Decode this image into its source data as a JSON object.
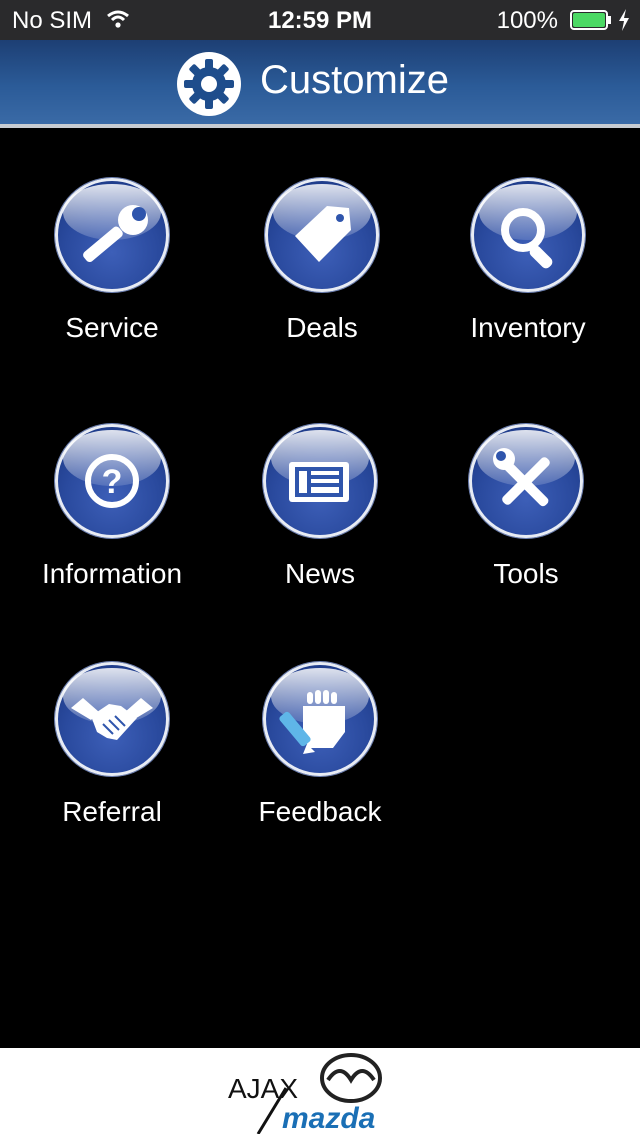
{
  "status_bar": {
    "carrier": "No SIM",
    "time": "12:59 PM",
    "battery_percent": "100%",
    "battery_level": 1.0,
    "icons": [
      "wifi-icon",
      "battery-icon",
      "charging-bolt-icon"
    ]
  },
  "header": {
    "title": "Customize",
    "icon": "gear-icon",
    "background_color": "#2b5b98"
  },
  "menu": {
    "items": [
      {
        "label": "Service",
        "icon": "wrench-icon"
      },
      {
        "label": "Deals",
        "icon": "price-tag-icon"
      },
      {
        "label": "Inventory",
        "icon": "magnifier-icon"
      },
      {
        "label": "Information",
        "icon": "question-mark-icon"
      },
      {
        "label": "News",
        "icon": "newspaper-icon"
      },
      {
        "label": "Tools",
        "icon": "wrench-screwdriver-icon"
      },
      {
        "label": "Referral",
        "icon": "handshake-icon"
      },
      {
        "label": "Feedback",
        "icon": "pen-hand-icon"
      }
    ]
  },
  "footer": {
    "logo_text": "AJAX",
    "brand_text": "mazda",
    "brand_color": "#1a6fb5"
  }
}
